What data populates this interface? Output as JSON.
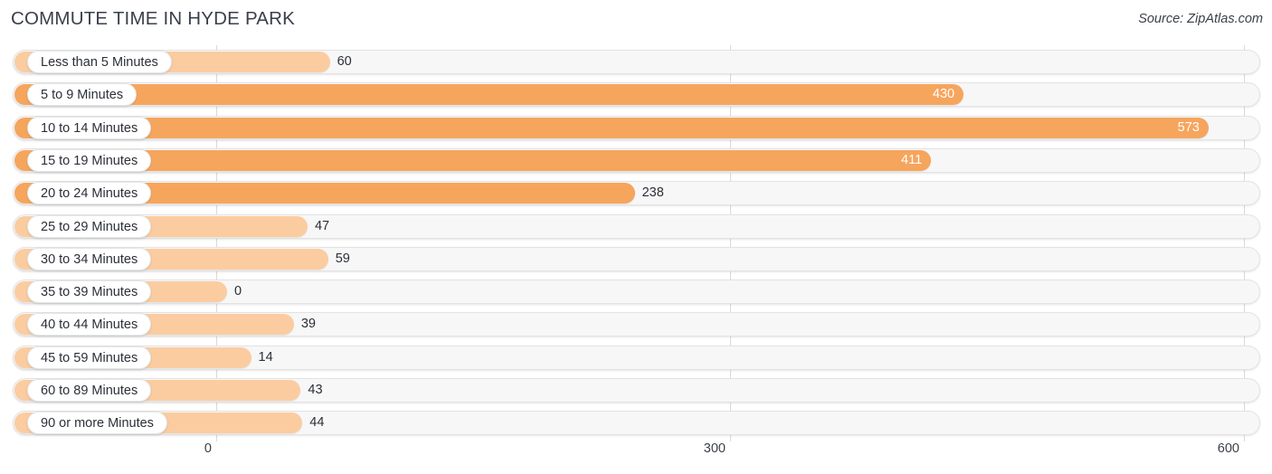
{
  "header": {
    "title": "COMMUTE TIME IN HYDE PARK",
    "source": "Source: ZipAtlas.com"
  },
  "colors": {
    "bar_strong": "#f6a55d",
    "bar_light": "#fbcca0",
    "track": "#f7f7f7",
    "track_border": "#e3e3e3",
    "gridline": "#d9d9d9",
    "text": "#2b2f38",
    "value_inside": "#ffffff"
  },
  "chart_data": {
    "type": "bar",
    "orientation": "horizontal",
    "title": "COMMUTE TIME IN HYDE PARK",
    "subtitle": "Source: ZipAtlas.com",
    "xlabel": "",
    "ylabel": "",
    "xlim": [
      0,
      600
    ],
    "grid": true,
    "legend": "none",
    "xticks": [
      0,
      300,
      600
    ],
    "xtick_labels": [
      "0",
      "300",
      "600"
    ],
    "categories": [
      "Less than 5 Minutes",
      "5 to 9 Minutes",
      "10 to 14 Minutes",
      "15 to 19 Minutes",
      "20 to 24 Minutes",
      "25 to 29 Minutes",
      "30 to 34 Minutes",
      "35 to 39 Minutes",
      "40 to 44 Minutes",
      "45 to 59 Minutes",
      "60 to 89 Minutes",
      "90 or more Minutes"
    ],
    "values": [
      60,
      430,
      573,
      411,
      238,
      47,
      59,
      0,
      39,
      14,
      43,
      44
    ],
    "value_labels": [
      "60",
      "430",
      "573",
      "411",
      "238",
      "47",
      "59",
      "0",
      "39",
      "14",
      "43",
      "44"
    ]
  },
  "rows": [
    {
      "label": "Less than 5 Minutes",
      "value": 60,
      "value_label": "60",
      "inside": false,
      "strong": false
    },
    {
      "label": "5 to 9 Minutes",
      "value": 430,
      "value_label": "430",
      "inside": true,
      "strong": true
    },
    {
      "label": "10 to 14 Minutes",
      "value": 573,
      "value_label": "573",
      "inside": true,
      "strong": true
    },
    {
      "label": "15 to 19 Minutes",
      "value": 411,
      "value_label": "411",
      "inside": true,
      "strong": true
    },
    {
      "label": "20 to 24 Minutes",
      "value": 238,
      "value_label": "238",
      "inside": false,
      "strong": true
    },
    {
      "label": "25 to 29 Minutes",
      "value": 47,
      "value_label": "47",
      "inside": false,
      "strong": false
    },
    {
      "label": "30 to 34 Minutes",
      "value": 59,
      "value_label": "59",
      "inside": false,
      "strong": false
    },
    {
      "label": "35 to 39 Minutes",
      "value": 0,
      "value_label": "0",
      "inside": false,
      "strong": false
    },
    {
      "label": "40 to 44 Minutes",
      "value": 39,
      "value_label": "39",
      "inside": false,
      "strong": false
    },
    {
      "label": "45 to 59 Minutes",
      "value": 14,
      "value_label": "14",
      "inside": false,
      "strong": false
    },
    {
      "label": "60 to 89 Minutes",
      "value": 43,
      "value_label": "43",
      "inside": false,
      "strong": false
    },
    {
      "label": "90 or more Minutes",
      "value": 44,
      "value_label": "44",
      "inside": false,
      "strong": false
    }
  ],
  "axis": {
    "ticks": [
      {
        "label": "0",
        "value": 0
      },
      {
        "label": "300",
        "value": 300
      },
      {
        "label": "600",
        "value": 600
      }
    ]
  }
}
